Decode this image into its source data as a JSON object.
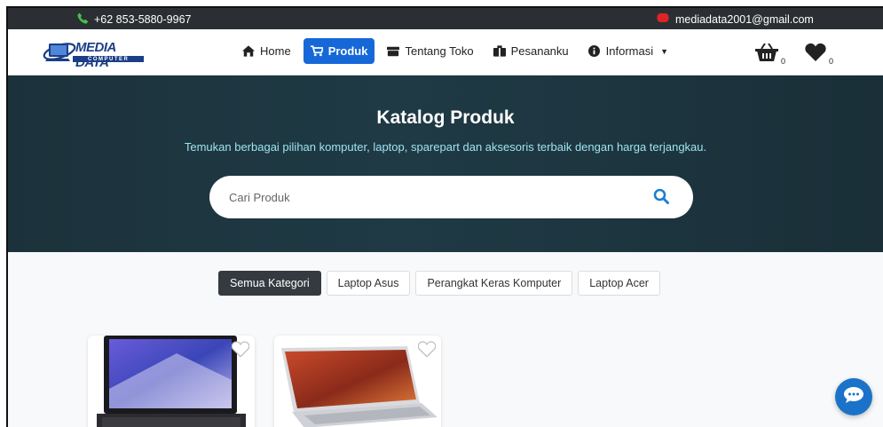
{
  "topbar": {
    "phone": "+62 853-5880-9967",
    "email": "mediadata2001@gmail.com"
  },
  "logo": {
    "title": "MEDIA DATA",
    "subtitle": "COMPUTER"
  },
  "nav": {
    "items": [
      {
        "label": "Home",
        "icon": "home-icon",
        "active": false
      },
      {
        "label": "Produk",
        "icon": "cart-icon",
        "active": true
      },
      {
        "label": "Tentang Toko",
        "icon": "store-icon",
        "active": false
      },
      {
        "label": "Pesananku",
        "icon": "orders-icon",
        "active": false
      },
      {
        "label": "Informasi",
        "icon": "info-icon",
        "active": false
      }
    ],
    "basket_count": "0",
    "wishlist_count": "0"
  },
  "hero": {
    "title": "Katalog Produk",
    "subtitle": "Temukan berbagai pilihan komputer, laptop, sparepart dan aksesoris terbaik dengan harga terjangkau.",
    "search_placeholder": "Cari Produk"
  },
  "categories": [
    {
      "label": "Semua Kategori",
      "active": true
    },
    {
      "label": "Laptop Asus",
      "active": false
    },
    {
      "label": "Perangkat Keras Komputer",
      "active": false
    },
    {
      "label": "Laptop Acer",
      "active": false
    }
  ],
  "colors": {
    "accent": "#1668d8",
    "hero_bg": "#1f3a45",
    "topbar_bg": "#2b2f33",
    "hero_subtitle": "#9ee3f0",
    "chat": "#1a73c9"
  }
}
